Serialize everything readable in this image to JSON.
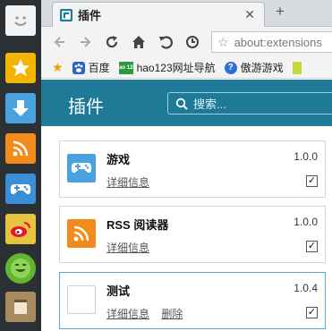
{
  "tab": {
    "title": "插件",
    "close": "✕",
    "new_tab": "+"
  },
  "address_bar": {
    "star": "☆",
    "url": "about:extensions"
  },
  "bookmarks": [
    {
      "label": "百度",
      "icon": "paw-icon",
      "color": "#2b64c9"
    },
    {
      "label": "hao123网址导航",
      "icon": "hao123-icon",
      "color": "#2a9a3a",
      "icon_text": "hao 123"
    },
    {
      "label": "傲游游戏",
      "icon": "question-icon",
      "color": "#2f6fd0"
    }
  ],
  "header": {
    "title": "插件",
    "search_placeholder": "搜索..."
  },
  "extensions": [
    {
      "name": "游戏",
      "version": "1.0.0",
      "links": [
        "详细信息"
      ],
      "enabled": true,
      "icon": "gamepad-icon",
      "icon_bg": "#4aa3df"
    },
    {
      "name": "RSS 阅读器",
      "version": "1.0.0",
      "links": [
        "详细信息"
      ],
      "enabled": true,
      "icon": "rss-icon",
      "icon_bg": "#f28a1c"
    },
    {
      "name": "测试",
      "version": "1.0.4",
      "links": [
        "详细信息",
        "删除"
      ],
      "enabled": true,
      "icon": "blank-icon",
      "icon_bg": "#ffffff"
    }
  ],
  "sidebar": [
    {
      "icon": "smiley-icon",
      "color": "#f2f2f2"
    },
    {
      "icon": "star-icon",
      "color": "#f5b400"
    },
    {
      "icon": "download-icon",
      "color": "#4aa3df"
    },
    {
      "icon": "rss-icon",
      "color": "#f28a1c"
    },
    {
      "icon": "gamepad-icon",
      "color": "#3a8fd6"
    },
    {
      "icon": "weibo-icon",
      "color": "#e6c440"
    },
    {
      "icon": "smiley-icon",
      "color": "#62b52f"
    },
    {
      "icon": "note-icon",
      "color": "#a88a60"
    }
  ]
}
